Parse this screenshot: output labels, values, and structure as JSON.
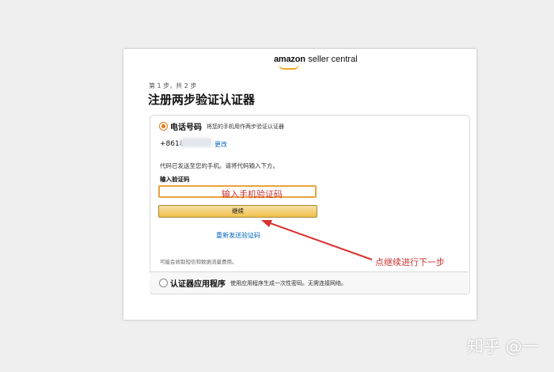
{
  "header": {
    "logo_brand": "amazon",
    "logo_product": "seller central"
  },
  "step_text": "第 1 步，共 2 步",
  "page_title": "注册两步验证认证器",
  "options": [
    {
      "label": "电话号码",
      "desc": "将您的手机用作两步验证认证器",
      "selected": true,
      "phone_prefix": "+8618",
      "change_link": "更改",
      "sent_notice": "代码已发送至您的手机。请将代码输入下方。",
      "code_label": "输入验证码",
      "code_input_value": "",
      "continue_label": "继续",
      "resend_link": "重新发送验证码",
      "sms_note": "可能会收取短信和数据流量费用。"
    },
    {
      "label": "认证器应用程序",
      "desc": "使用应用程序生成一次性密码。无需连接网络。",
      "selected": false
    }
  ],
  "annotations": {
    "input_hint": "输入手机验证码",
    "arrow_hint": "点继续进行下一步"
  },
  "watermark": "知乎 @一",
  "colors": {
    "accent": "#e47911",
    "link": "#0066c0",
    "annotation": "#c8322f",
    "button": "#f0c14b"
  }
}
